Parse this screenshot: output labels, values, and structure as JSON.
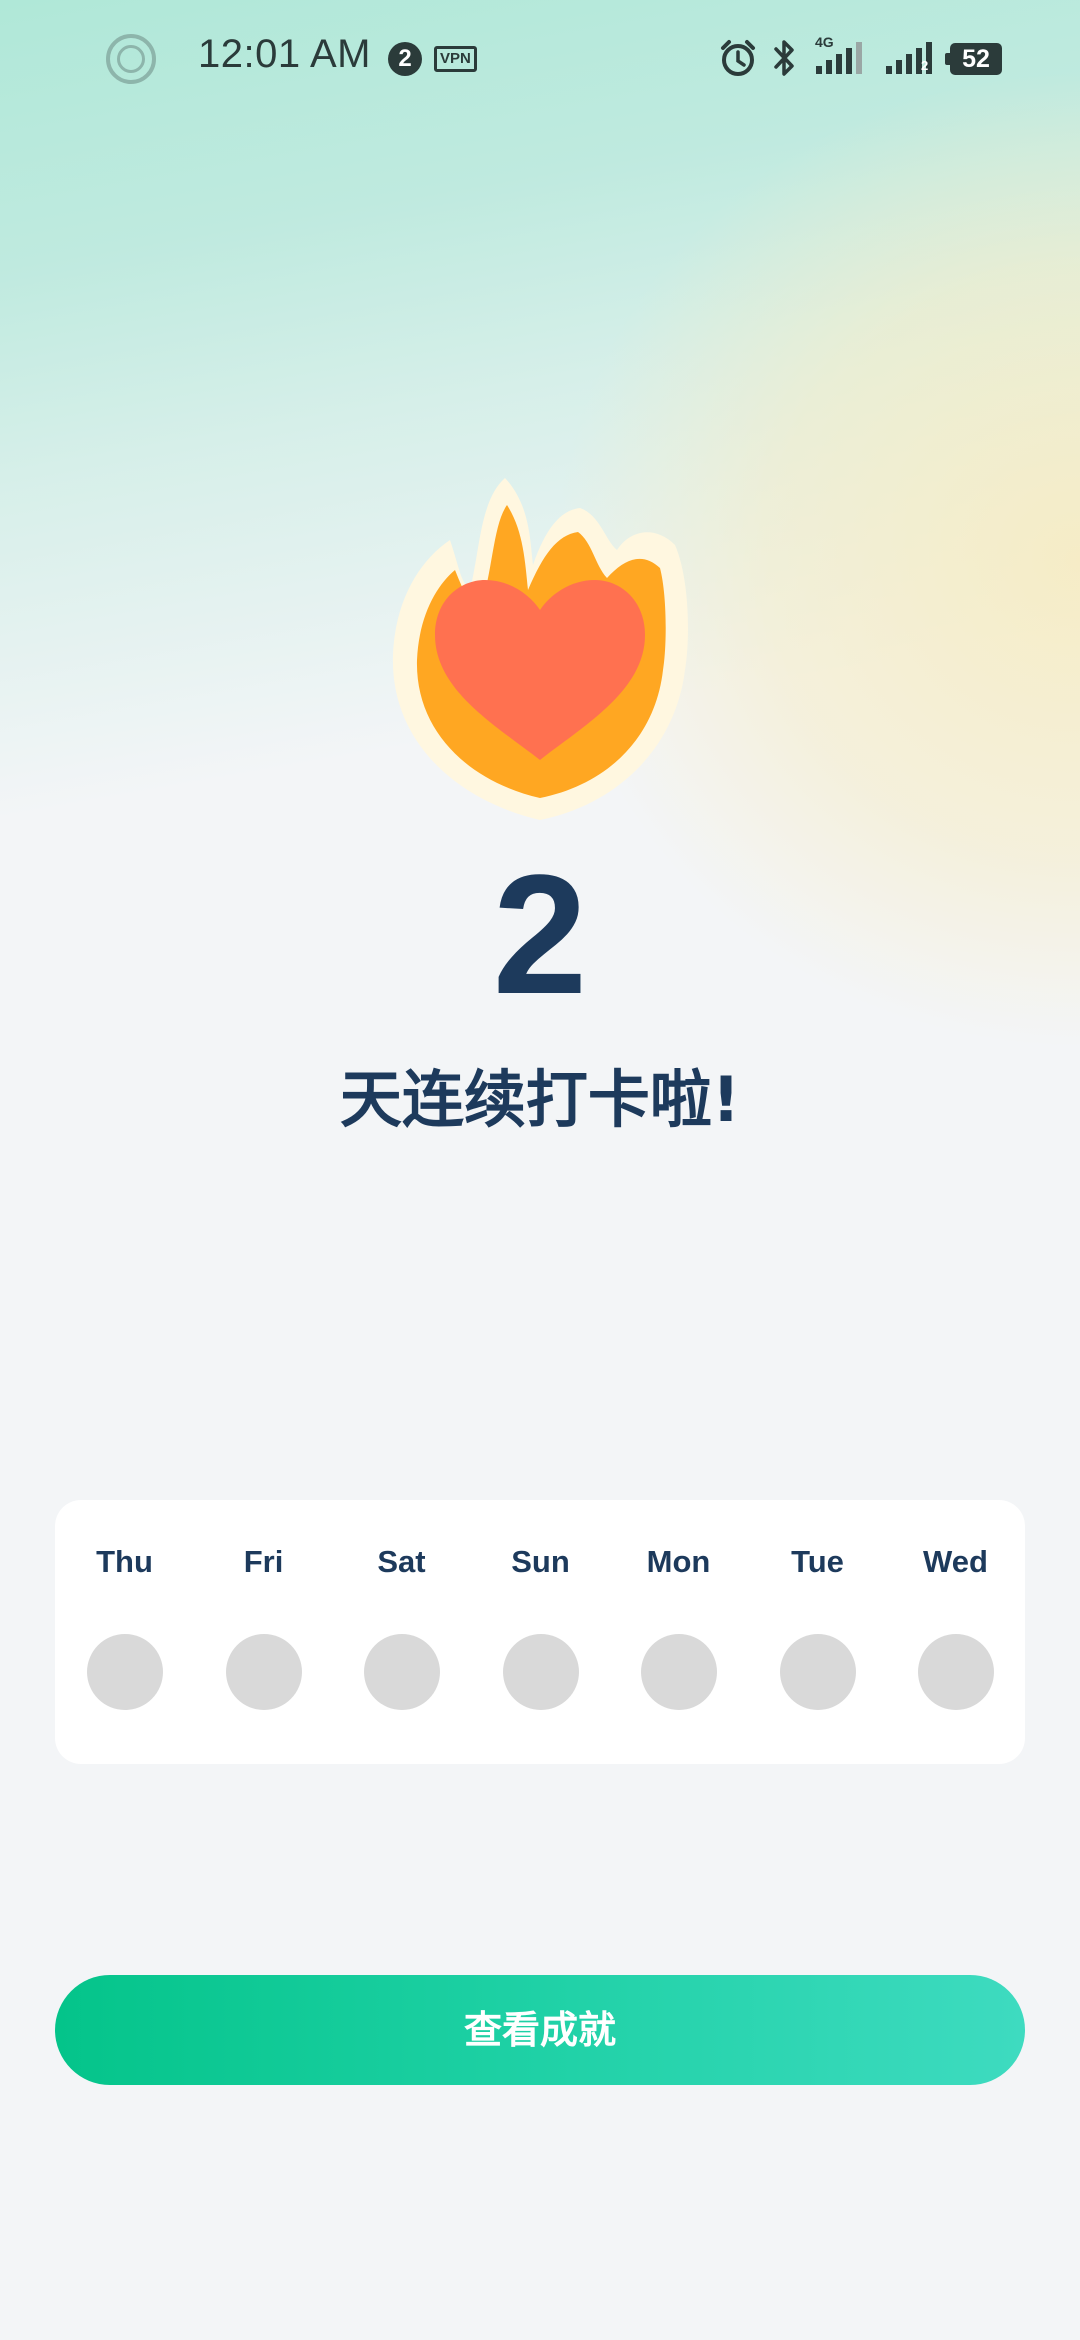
{
  "status_bar": {
    "time": "12:01 AM",
    "notification_count": "2",
    "vpn_label": "VPN",
    "network_label": "4G",
    "sim2_label": "2",
    "battery": "52",
    "icons": [
      "record-icon",
      "alarm-icon",
      "bluetooth-icon",
      "signal-4g-icon",
      "signal-sim2-icon",
      "battery-icon"
    ]
  },
  "streak": {
    "count": "2",
    "message": "天连续打卡啦!",
    "icon": "flame-heart-icon"
  },
  "week": {
    "days": [
      {
        "label": "Thu",
        "checked": false
      },
      {
        "label": "Fri",
        "checked": false
      },
      {
        "label": "Sat",
        "checked": false
      },
      {
        "label": "Sun",
        "checked": false
      },
      {
        "label": "Mon",
        "checked": false
      },
      {
        "label": "Tue",
        "checked": false
      },
      {
        "label": "Wed",
        "checked": false
      }
    ],
    "unchecked_color": "#d9d9d9"
  },
  "action": {
    "button_label": "查看成就"
  },
  "colors": {
    "primary_text": "#1d3a5c",
    "accent_green": "#04c48a",
    "flame_orange": "#ffa722",
    "heart_red": "#ff7150"
  }
}
